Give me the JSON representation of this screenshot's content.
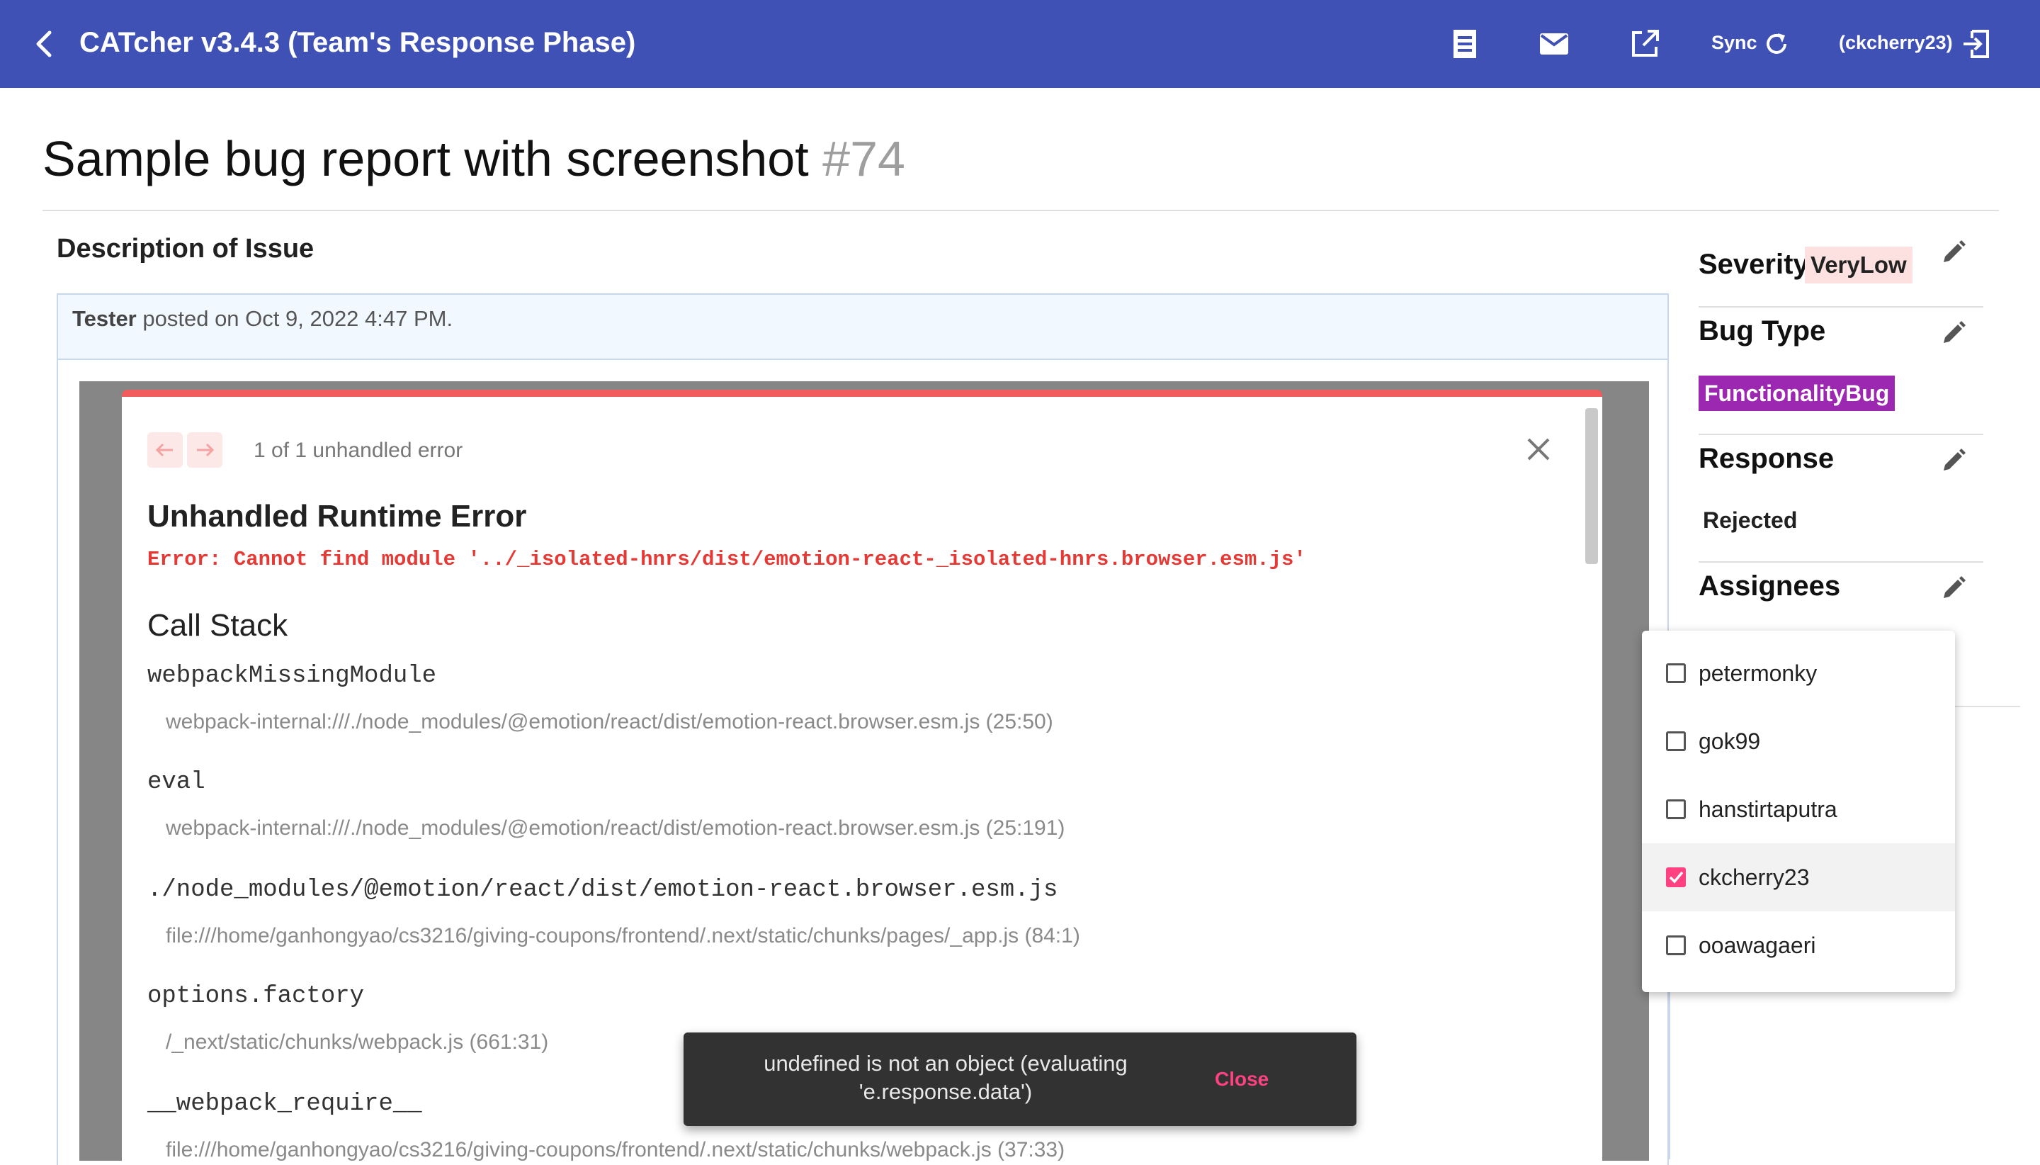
{
  "app_bar": {
    "title": "CATcher v3.4.3  (Team's Response Phase)",
    "sync_label": "Sync",
    "user_label": "(ckcherry23)"
  },
  "issue": {
    "title": "Sample bug report with screenshot",
    "number": "#74"
  },
  "description": {
    "heading": "Description of Issue",
    "author": "Tester",
    "posted": "posted on Oct 9, 2022 4:47 PM."
  },
  "screenshot": {
    "counter": "1 of 1 unhandled error",
    "error_title": "Unhandled Runtime Error",
    "error_message": "Error: Cannot find module '../_isolated-hnrs/dist/emotion-react-_isolated-hnrs.browser.esm.js'",
    "stack_title": "Call Stack",
    "frames": [
      {
        "fn": "webpackMissingModule",
        "loc": "webpack-internal:///./node_modules/@emotion/react/dist/emotion-react.browser.esm.js (25:50)"
      },
      {
        "fn": "eval",
        "loc": "webpack-internal:///./node_modules/@emotion/react/dist/emotion-react.browser.esm.js (25:191)"
      },
      {
        "fn": "./node_modules/@emotion/react/dist/emotion-react.browser.esm.js",
        "loc": "file:///home/ganhongyao/cs3216/giving-coupons/frontend/.next/static/chunks/pages/_app.js (84:1)"
      },
      {
        "fn": "options.factory",
        "loc": "/_next/static/chunks/webpack.js (661:31)"
      },
      {
        "fn": "__webpack_require__",
        "loc": "file:///home/ganhongyao/cs3216/giving-coupons/frontend/.next/static/chunks/webpack.js (37:33)"
      }
    ]
  },
  "sidebar": {
    "severity_label": "Severity",
    "severity_value": "VeryLow",
    "bug_type_label": "Bug Type",
    "bug_type_value": "FunctionalityBug",
    "response_label": "Response",
    "response_value": "Rejected",
    "assignees_label": "Assignees"
  },
  "assignee_options": [
    {
      "name": "petermonky",
      "checked": false
    },
    {
      "name": "gok99",
      "checked": false
    },
    {
      "name": "hanstirtaputra",
      "checked": false
    },
    {
      "name": "ckcherry23",
      "checked": true
    },
    {
      "name": "ooawagaeri",
      "checked": false
    }
  ],
  "snackbar": {
    "message": "undefined is not an object (evaluating 'e.response.data')",
    "action": "Close"
  },
  "colors": {
    "app_bar": "#3f51b5",
    "severity_badge": "#fde0e0",
    "bug_type_badge": "#9c27b0",
    "accent": "#ff4081",
    "error_red": "#e53935"
  },
  "icons": [
    "back-arrow-icon",
    "document-icon",
    "mail-icon",
    "open-external-icon",
    "sync-icon",
    "logout-icon",
    "pencil-icon",
    "close-icon"
  ]
}
